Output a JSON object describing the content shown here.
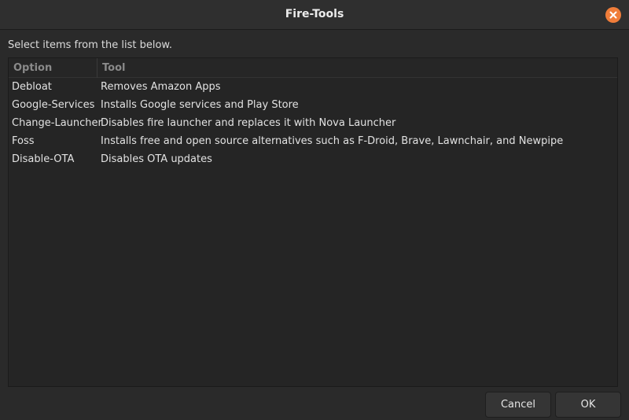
{
  "window": {
    "title": "Fire-Tools",
    "close_icon": "close-icon"
  },
  "instruction": "Select items from the list below.",
  "list": {
    "columns": [
      "Option",
      "Tool"
    ],
    "rows": [
      {
        "option": "Debloat",
        "tool": "Removes Amazon Apps"
      },
      {
        "option": "Google-Services",
        "tool": "Installs Google services and Play Store"
      },
      {
        "option": "Change-Launcher",
        "tool": "Disables fire launcher and replaces it with Nova Launcher"
      },
      {
        "option": "Foss",
        "tool": "Installs free and open source alternatives such as F-Droid, Brave, Lawnchair, and Newpipe"
      },
      {
        "option": "Disable-OTA",
        "tool": "Disables OTA updates"
      }
    ]
  },
  "buttons": {
    "cancel": "Cancel",
    "ok": "OK"
  },
  "colors": {
    "accent": "#f07d3a",
    "background": "#2a2a2a"
  }
}
